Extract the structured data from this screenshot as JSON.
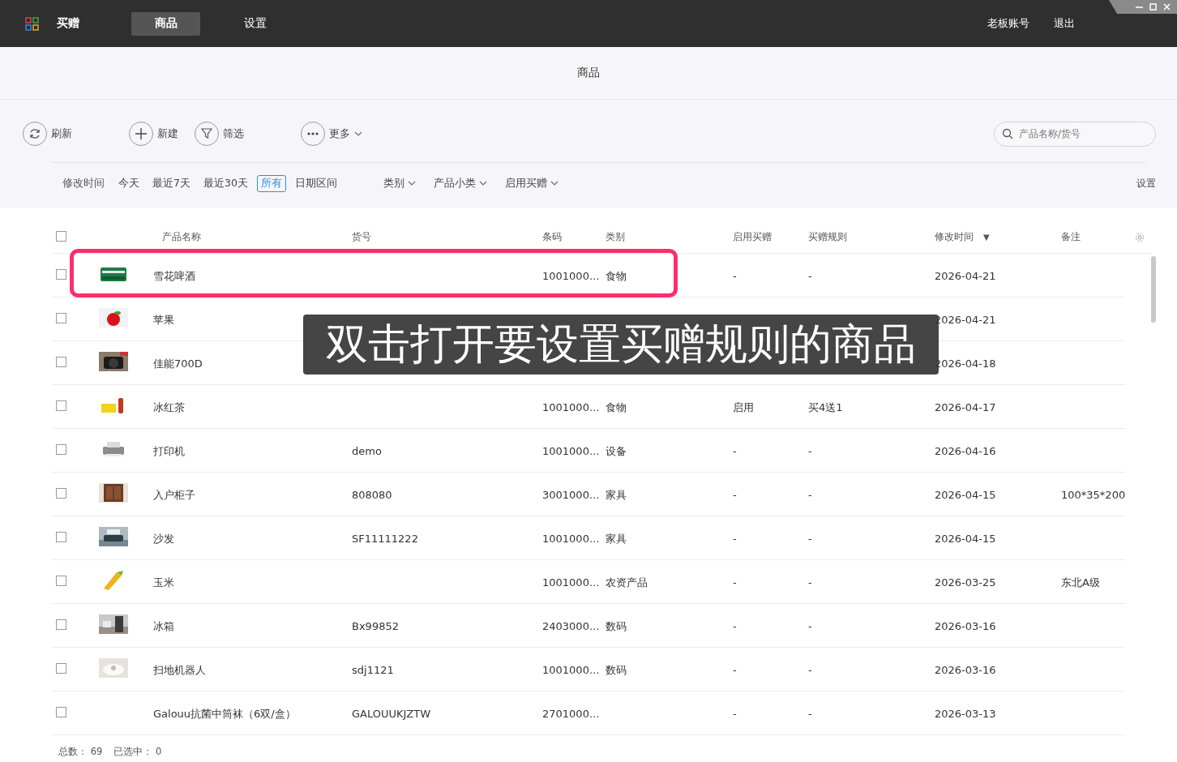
{
  "app": {
    "name": "买赠"
  },
  "nav_tabs": [
    {
      "label": "商品",
      "selected": true
    },
    {
      "label": "设置",
      "selected": false
    }
  ],
  "account": {
    "user": "老板账号",
    "logout": "退出"
  },
  "page_title": "商品",
  "actions": [
    {
      "label": "刷新",
      "kind": "refresh"
    },
    {
      "label": "新建",
      "kind": "add"
    },
    {
      "label": "筛选",
      "kind": "filter"
    },
    {
      "label": "更多",
      "kind": "more"
    }
  ],
  "search": {
    "placeholder": "产品名称/货号"
  },
  "time_filter": {
    "label": "修改时间",
    "options": [
      {
        "label": "今天",
        "selected": false
      },
      {
        "label": "最近7天",
        "selected": false
      },
      {
        "label": "最近30天",
        "selected": false
      },
      {
        "label": "所有",
        "selected": true
      },
      {
        "label": "日期区间",
        "selected": false
      }
    ]
  },
  "dropdowns": [
    "类别",
    "产品小类",
    "启用买赠"
  ],
  "settings_link": "设置",
  "table": {
    "all_checked": false,
    "columns": [
      "产品名称",
      "货号",
      "条码",
      "类别",
      "启用买赠",
      "买赠规则",
      "修改时间",
      "备注"
    ],
    "sort_mark": "▼",
    "rows": [
      {
        "checked": false,
        "name": "雪花啤酒",
        "sku": "",
        "barcode": "1001000...",
        "category": "食物",
        "buy_gift": "-",
        "rule": "-",
        "modified": "2026-04-21",
        "note": ""
      },
      {
        "checked": false,
        "name": "苹果",
        "modified": "2026-04-21"
      },
      {
        "checked": false,
        "name": "佳能700D",
        "modified": "2026-04-18"
      },
      {
        "checked": false,
        "name": "冰红茶",
        "sku": "",
        "barcode": "1001000...",
        "category": "食物",
        "buy_gift": "启用",
        "rule": "买4送1",
        "modified": "2026-04-17",
        "note": ""
      },
      {
        "checked": false,
        "name": "打印机",
        "sku": "demo",
        "barcode": "1001000...",
        "category": "设备",
        "buy_gift": "-",
        "rule": "-",
        "modified": "2026-04-16",
        "note": ""
      },
      {
        "checked": false,
        "name": "入户柜子",
        "sku": "808080",
        "barcode": "3001000...",
        "category": "家具",
        "buy_gift": "-",
        "rule": "-",
        "modified": "2026-04-15",
        "note": "100*35*200"
      },
      {
        "checked": false,
        "name": "沙发",
        "sku": "SF11111222",
        "barcode": "1001000...",
        "category": "家具",
        "buy_gift": "-",
        "rule": "-",
        "modified": "2026-04-15",
        "note": ""
      },
      {
        "checked": false,
        "name": "玉米",
        "sku": "",
        "barcode": "1001000...",
        "category": "农资产品",
        "buy_gift": "-",
        "rule": "-",
        "modified": "2026-03-25",
        "note": "东北A级"
      },
      {
        "checked": false,
        "name": "冰箱",
        "sku": "Bx99852",
        "barcode": "2403000...",
        "category": "数码",
        "buy_gift": "-",
        "rule": "-",
        "modified": "2026-03-16",
        "note": ""
      },
      {
        "checked": false,
        "name": "扫地机器人",
        "sku": "sdj1121",
        "barcode": "1001000...",
        "category": "数码",
        "buy_gift": "-",
        "rule": "-",
        "modified": "2026-03-16",
        "note": ""
      },
      {
        "checked": false,
        "name": "Galouu抗菌中筒袜（6双/盒）",
        "sku": "GALOUUKJZTW",
        "barcode": "2701000...",
        "category": "",
        "buy_gift": "-",
        "rule": "-",
        "modified": "2026-03-13",
        "note": ""
      }
    ]
  },
  "footer": {
    "total_label": "总数：",
    "total": "69",
    "selected_label": "已选中：",
    "selected": "0"
  },
  "annotation": {
    "caption": "双击打开要设置买赠规则的商品"
  }
}
